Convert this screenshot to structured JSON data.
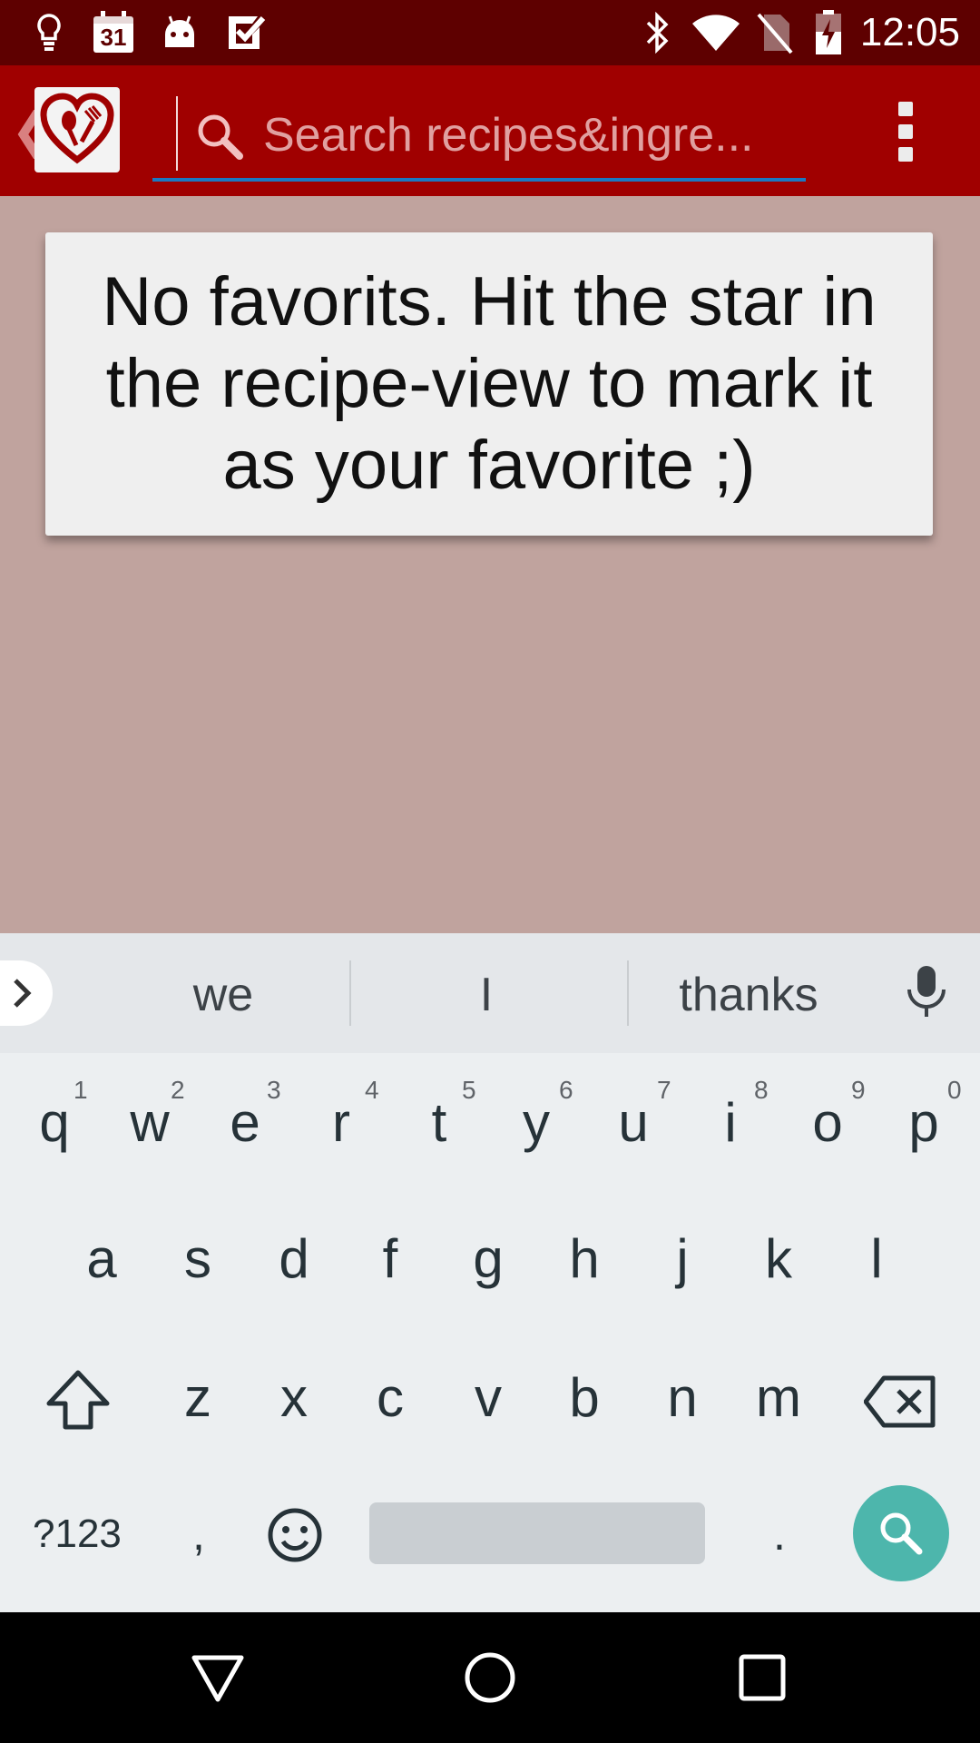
{
  "status_bar": {
    "time": "12:05",
    "calendar_day": "31",
    "left_icons": [
      "lightbulb-icon",
      "calendar-icon",
      "android-icon",
      "checkmark-icon"
    ],
    "right_icons": [
      "bluetooth-icon",
      "wifi-icon",
      "no-sim-icon",
      "battery-charging-icon"
    ]
  },
  "app_bar": {
    "search_placeholder": "Search recipes&ingre...",
    "logo": "heart-fork-spoon-logo",
    "accent_color": "#a00000"
  },
  "main": {
    "empty_message": "No favorits. Hit the star in the recipe-view to mark it as your favorite ;)"
  },
  "keyboard": {
    "suggestions": [
      "we",
      "I",
      "thanks"
    ],
    "row1": [
      "q",
      "w",
      "e",
      "r",
      "t",
      "y",
      "u",
      "i",
      "o",
      "p"
    ],
    "row1_hints": [
      "1",
      "2",
      "3",
      "4",
      "5",
      "6",
      "7",
      "8",
      "9",
      "0"
    ],
    "row2": [
      "a",
      "s",
      "d",
      "f",
      "g",
      "h",
      "j",
      "k",
      "l"
    ],
    "row3": [
      "z",
      "x",
      "c",
      "v",
      "b",
      "n",
      "m"
    ],
    "symbols_label": "?123",
    "comma": ",",
    "period": ".",
    "search_key_color": "#4db6ac"
  },
  "nav_bar": {
    "buttons": [
      "back-icon",
      "home-icon",
      "recents-icon"
    ]
  }
}
